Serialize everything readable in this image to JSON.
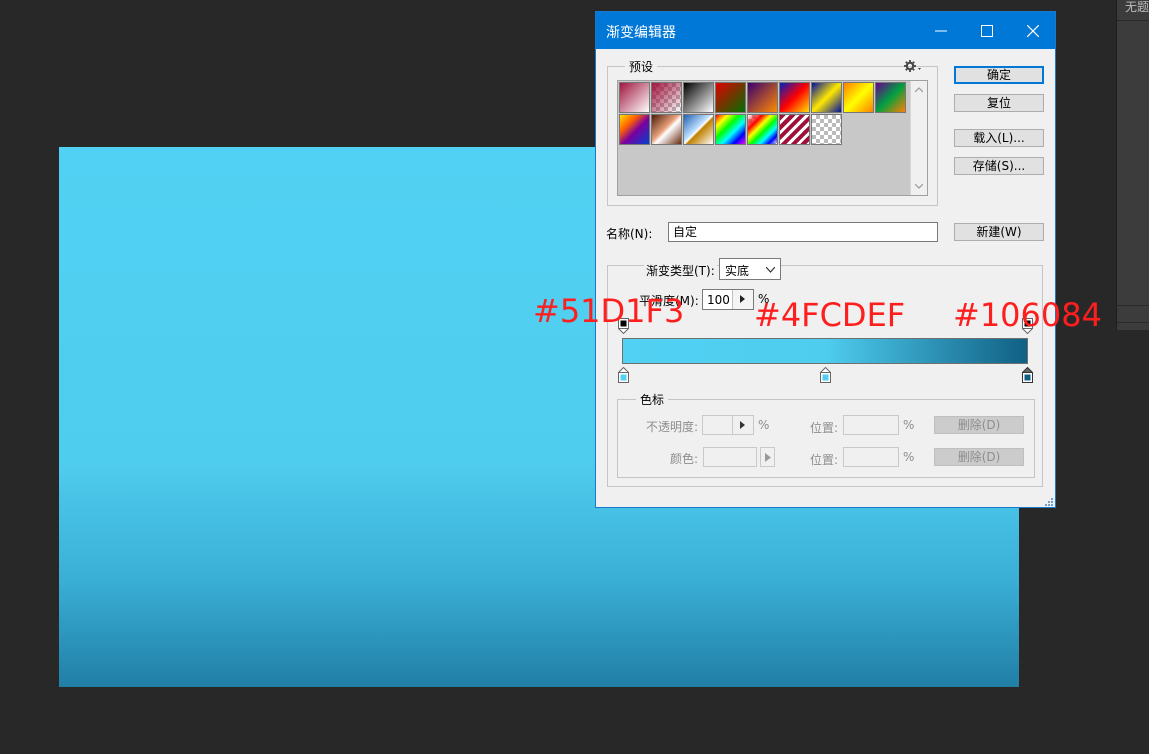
{
  "background_panel": {
    "tab_text": "无题"
  },
  "dialog": {
    "title": "渐变编辑器",
    "presets": {
      "legend": "预设",
      "swatches": [
        "crimson-white",
        "crimson-transparent",
        "black-white",
        "red-green",
        "violet-orange",
        "blue-red-yellow",
        "blue-yellow-blue",
        "orange-yellow-orange",
        "violet-green-orange",
        "yellow-violet-orange-blue",
        "copper",
        "chrome",
        "spectrum",
        "transparent-rainbow",
        "transparent-stripes",
        "neutral-density"
      ]
    },
    "buttons": {
      "ok": "确定",
      "reset": "复位",
      "load": "载入(L)...",
      "save": "存储(S)...",
      "new": "新建(W)"
    },
    "name": {
      "label": "名称(N):",
      "value": "自定"
    },
    "gradient_type": {
      "label": "渐变类型(T):",
      "value": "实底"
    },
    "smoothness": {
      "label": "平滑度(M):",
      "value": "100",
      "unit": "%"
    },
    "gradient": {
      "colors": [
        "#51d1f3",
        "#4fcdef",
        "#106084"
      ],
      "stop_positions": [
        0,
        50,
        100
      ]
    },
    "color_stops": {
      "legend": "色标",
      "opacity_label": "不透明度:",
      "opacity_unit": "%",
      "location_label_1": "位置:",
      "location_unit_1": "%",
      "delete_1": "删除(D)",
      "color_label": "颜色:",
      "location_label_2": "位置:",
      "location_unit_2": "%",
      "delete_2": "删除(D)"
    }
  },
  "annotations": {
    "left": "#51D1F3",
    "middle": "#4FCDEF",
    "right": "#106084"
  }
}
